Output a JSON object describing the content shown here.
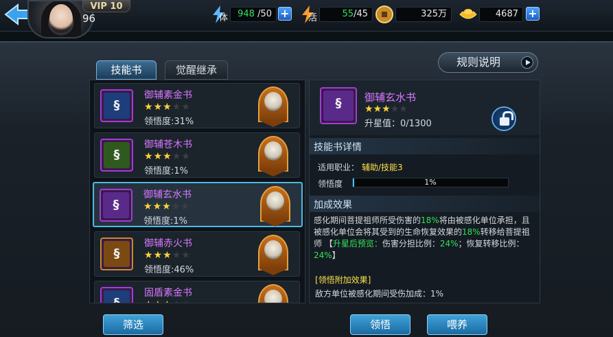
{
  "header": {
    "vip": "VIP 10",
    "level": "96",
    "stamina": {
      "icon": "stamina-icon",
      "label": "体",
      "value": "948",
      "max": "/50"
    },
    "vigor": {
      "icon": "vigor-icon",
      "label": "活",
      "value": "55",
      "max": "/45"
    },
    "coins": {
      "icon": "coin-icon",
      "value": "325万"
    },
    "gold": {
      "icon": "gold-ingot-icon",
      "value": "4687"
    }
  },
  "tabs": [
    {
      "label": "技能书"
    },
    {
      "label": "觉醒继承"
    }
  ],
  "rules_button": "规则说明",
  "books": [
    {
      "name": "御辅素金书",
      "stars": 3,
      "max_stars": 5,
      "sub": "领悟度:31%",
      "color": "#1d3e7a"
    },
    {
      "name": "御辅苍木书",
      "stars": 3,
      "max_stars": 5,
      "sub": "领悟度:1%",
      "color": "#2f5a1f"
    },
    {
      "name": "御辅玄水书",
      "stars": 3,
      "max_stars": 5,
      "sub": "领悟度:1%",
      "color": "#5a2a8a"
    },
    {
      "name": "御辅赤火书",
      "stars": 3,
      "max_stars": 5,
      "sub": "领悟度:46%",
      "color": "#7a4a12"
    },
    {
      "name": "固盾素金书",
      "stars": 3,
      "max_stars": 5,
      "sub": "",
      "color": "#1d3e7a"
    }
  ],
  "filter_button": "筛选",
  "detail": {
    "name": "御辅玄水书",
    "stars": 3,
    "max_stars": 5,
    "upgrade_value": "升星值：0/1300",
    "section_details": "技能书详情",
    "job_label": "适用职业：",
    "job_value": "辅助/技能3",
    "comprehension_label": "领悟度",
    "comprehension_text": "1%",
    "comprehension_fraction": 0.01,
    "section_bonus": "加成效果",
    "desc": {
      "p1": "感化期间菩提祖师所受伤害的",
      "v1": "18%",
      "p2": "将由被感化单位承担，且被感化单位会将其受到的生命恢复效果的",
      "v2": "18%",
      "p3": "转移给菩提祖师 【",
      "preview": "升星后预览：",
      "p4": "伤害分担比例：",
      "v3": "24%",
      "p5": "；恢复转移比例：",
      "v4": "24%",
      "p6": "】"
    },
    "extra_title": "[领悟附加效果]",
    "extra_text": "敌方单位被感化期间受伤加成：1%"
  },
  "actions": {
    "comprehend": "领悟",
    "feed": "喂养"
  }
}
